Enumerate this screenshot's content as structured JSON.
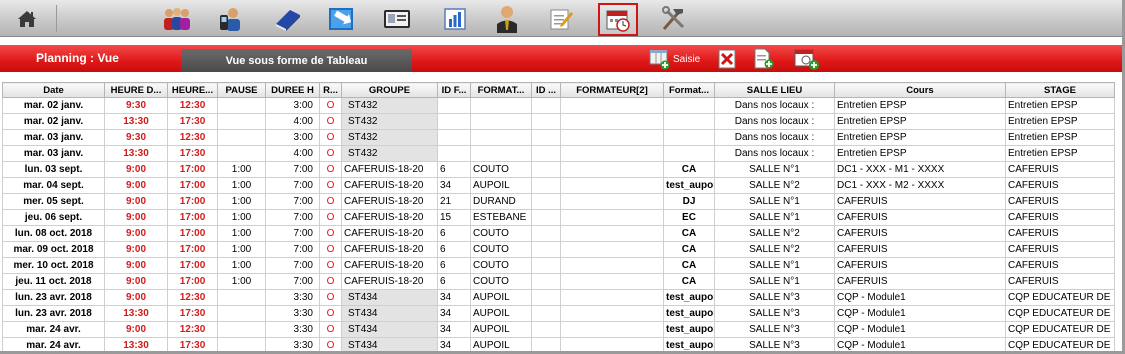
{
  "toolbar": {
    "icons": [
      "home-icon",
      "users-icon",
      "phone-contact-icon",
      "book-icon",
      "import-arrow-icon",
      "id-card-icon",
      "bar-chart-icon",
      "person-icon",
      "edit-notepad-icon",
      "calendar-clock-icon",
      "tools-icon"
    ],
    "active_icon": "calendar-clock-icon"
  },
  "header": {
    "title": "Planning : Vue",
    "view_tab": "Vue sous forme de Tableau",
    "saisie_label": "Saisie",
    "accent_color": "#df1717"
  },
  "table": {
    "columns": [
      "Date",
      "HEURE D...",
      "HEURE...",
      "PAUSE",
      "DUREE H",
      "R...",
      "GROUPE",
      "ID F...",
      "FORMAT...",
      "ID ...",
      "FORMATEUR[2]",
      "Format...",
      "SALLE LIEU",
      "Cours",
      "STAGE"
    ],
    "rows": [
      [
        "mar. 02 janv.",
        "9:30",
        "12:30",
        "",
        "3:00",
        "O",
        "ST432",
        "",
        "",
        "",
        "",
        "",
        "Dans nos locaux :",
        "Entretien EPSP",
        "Entretien EPSP"
      ],
      [
        "mar. 02 janv.",
        "13:30",
        "17:30",
        "",
        "4:00",
        "O",
        "ST432",
        "",
        "",
        "",
        "",
        "",
        "Dans nos locaux :",
        "Entretien EPSP",
        "Entretien EPSP"
      ],
      [
        "mar. 03 janv.",
        "9:30",
        "12:30",
        "",
        "3:00",
        "O",
        "ST432",
        "",
        "",
        "",
        "",
        "",
        "Dans nos locaux :",
        "Entretien EPSP",
        "Entretien EPSP"
      ],
      [
        "mar. 03 janv.",
        "13:30",
        "17:30",
        "",
        "4:00",
        "O",
        "ST432",
        "",
        "",
        "",
        "",
        "",
        "Dans nos locaux :",
        "Entretien EPSP",
        "Entretien EPSP"
      ],
      [
        "lun. 03 sept.",
        "9:00",
        "17:00",
        "1:00",
        "7:00",
        "O",
        "CAFERUIS-18-20",
        "6",
        "COUTO",
        "",
        "",
        "CA",
        "SALLE N°1",
        "DC1 - XXX - M1 - XXXX",
        "CAFERUIS"
      ],
      [
        "mar. 04 sept.",
        "9:00",
        "17:00",
        "1:00",
        "7:00",
        "O",
        "CAFERUIS-18-20",
        "34",
        "AUPOIL",
        "",
        "",
        "test_aupoil",
        "SALLE N°2",
        "DC1 - XXX - M2 - XXXX",
        "CAFERUIS"
      ],
      [
        "mer. 05 sept.",
        "9:00",
        "17:00",
        "1:00",
        "7:00",
        "O",
        "CAFERUIS-18-20",
        "21",
        "DURAND",
        "",
        "",
        "DJ",
        "SALLE N°1",
        "CAFERUIS",
        "CAFERUIS"
      ],
      [
        "jeu. 06 sept.",
        "9:00",
        "17:00",
        "1:00",
        "7:00",
        "O",
        "CAFERUIS-18-20",
        "15",
        "ESTEBANE",
        "",
        "",
        "EC",
        "SALLE N°1",
        "CAFERUIS",
        "CAFERUIS"
      ],
      [
        "lun. 08 oct. 2018",
        "9:00",
        "17:00",
        "1:00",
        "7:00",
        "O",
        "CAFERUIS-18-20",
        "6",
        "COUTO",
        "",
        "",
        "CA",
        "SALLE N°2",
        "CAFERUIS",
        "CAFERUIS"
      ],
      [
        "mar. 09 oct. 2018",
        "9:00",
        "17:00",
        "1:00",
        "7:00",
        "O",
        "CAFERUIS-18-20",
        "6",
        "COUTO",
        "",
        "",
        "CA",
        "SALLE N°2",
        "CAFERUIS",
        "CAFERUIS"
      ],
      [
        "mer. 10 oct. 2018",
        "9:00",
        "17:00",
        "1:00",
        "7:00",
        "O",
        "CAFERUIS-18-20",
        "6",
        "COUTO",
        "",
        "",
        "CA",
        "SALLE N°1",
        "CAFERUIS",
        "CAFERUIS"
      ],
      [
        "jeu. 11 oct. 2018",
        "9:00",
        "17:00",
        "1:00",
        "7:00",
        "O",
        "CAFERUIS-18-20",
        "6",
        "COUTO",
        "",
        "",
        "CA",
        "SALLE N°1",
        "CAFERUIS",
        "CAFERUIS"
      ],
      [
        "lun. 23 avr. 2018",
        "9:00",
        "12:30",
        "",
        "3:30",
        "O",
        "ST434",
        "34",
        "AUPOIL",
        "",
        "",
        "test_aupoil",
        "SALLE N°3",
        "CQP - Module1",
        "CQP EDUCATEUR DE"
      ],
      [
        "lun. 23 avr. 2018",
        "13:30",
        "17:30",
        "",
        "3:30",
        "O",
        "ST434",
        "34",
        "AUPOIL",
        "",
        "",
        "test_aupoil",
        "SALLE N°3",
        "CQP - Module1",
        "CQP EDUCATEUR DE"
      ],
      [
        "mar. 24 avr.",
        "9:00",
        "12:30",
        "",
        "3:30",
        "O",
        "ST434",
        "34",
        "AUPOIL",
        "",
        "",
        "test_aupoil",
        "SALLE N°3",
        "CQP - Module1",
        "CQP EDUCATEUR DE"
      ],
      [
        "mar. 24 avr.",
        "13:30",
        "17:30",
        "",
        "3:30",
        "O",
        "ST434",
        "34",
        "AUPOIL",
        "",
        "",
        "test_aupoil",
        "SALLE N°3",
        "CQP - Module1",
        "CQP EDUCATEUR DE"
      ]
    ]
  }
}
